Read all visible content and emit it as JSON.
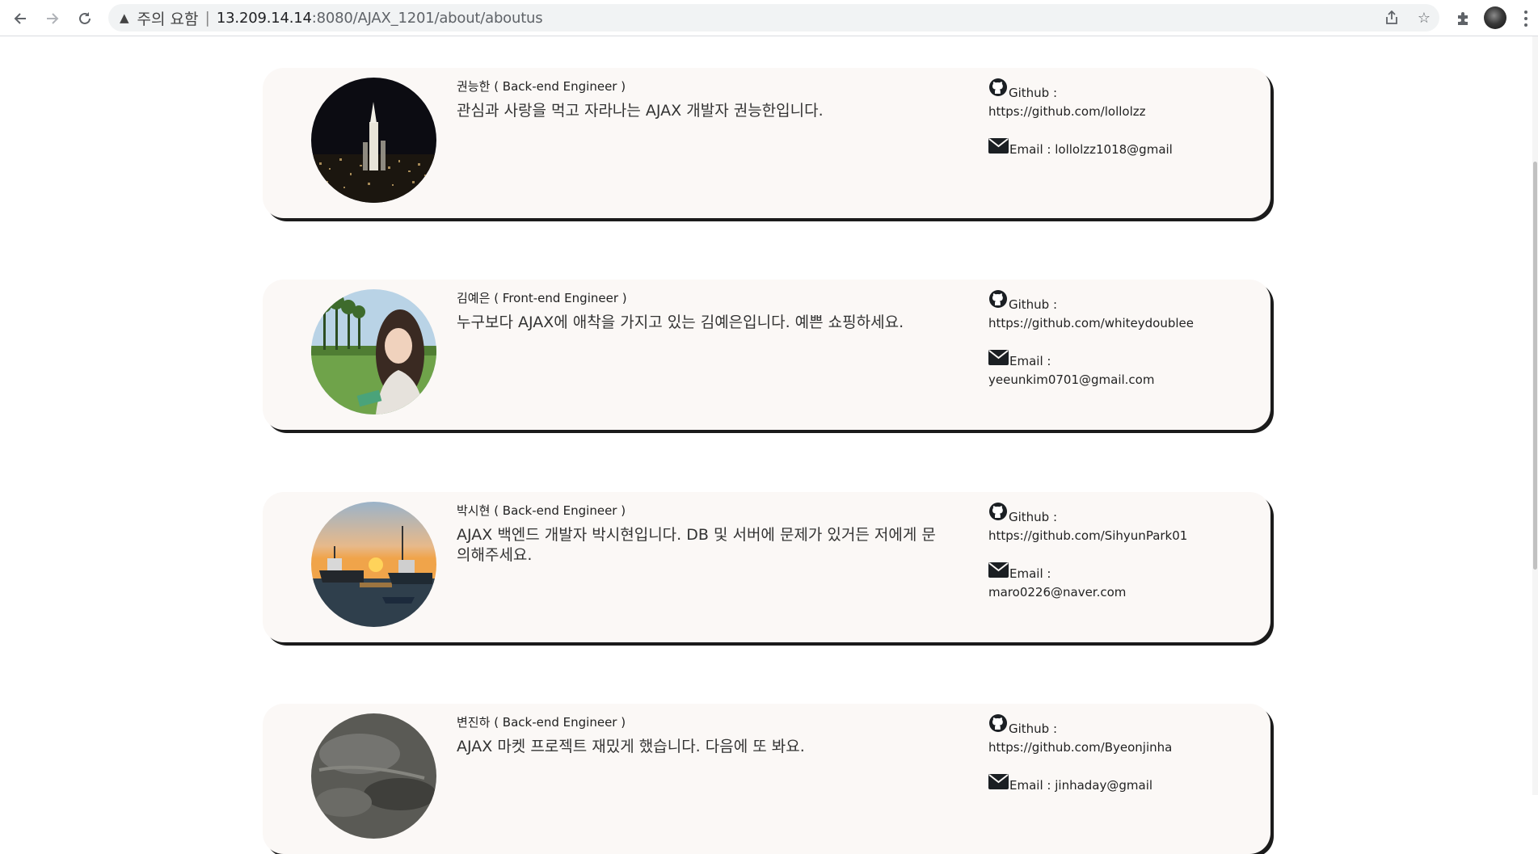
{
  "browser": {
    "security_label": "주의 요함",
    "url_host": "13.209.14.14",
    "url_rest": ":8080/AJAX_1201/about/aboutus"
  },
  "members": [
    {
      "name": "권능한",
      "role": "( Back-end Engineer )",
      "bio": "관심과 사랑을 먹고 자라나는 AJAX 개발자 권능한입니다.",
      "github_label": "Github :",
      "github_url": "https://github.com/lollolzz",
      "email_label": "Email :",
      "email": "lollolzz1018@gmail"
    },
    {
      "name": "김예은",
      "role": "( Front-end Engineer )",
      "bio": "누구보다 AJAX에 애착을 가지고 있는 김예은입니다. 예쁜 쇼핑하세요.",
      "github_label": "Github :",
      "github_url": "https://github.com/whiteydoublee",
      "email_label": "Email :",
      "email": "yeeunkim0701@gmail.com"
    },
    {
      "name": "박시현",
      "role": "( Back-end Engineer )",
      "bio": "AJAX 백엔드 개발자 박시현입니다. DB 및 서버에 문제가 있거든 저에게 문의해주세요.",
      "github_label": "Github :",
      "github_url": "https://github.com/SihyunPark01",
      "email_label": "Email :",
      "email": "maro0226@naver.com"
    },
    {
      "name": "변진하",
      "role": "( Back-end Engineer )",
      "bio": "AJAX 마켓 프로젝트 재밌게 했습니다. 다음에 또 봐요.",
      "github_label": "Github :",
      "github_url": "https://github.com/Byeonjinha",
      "email_label": "Email :",
      "email": "jinhaday@gmail"
    }
  ]
}
